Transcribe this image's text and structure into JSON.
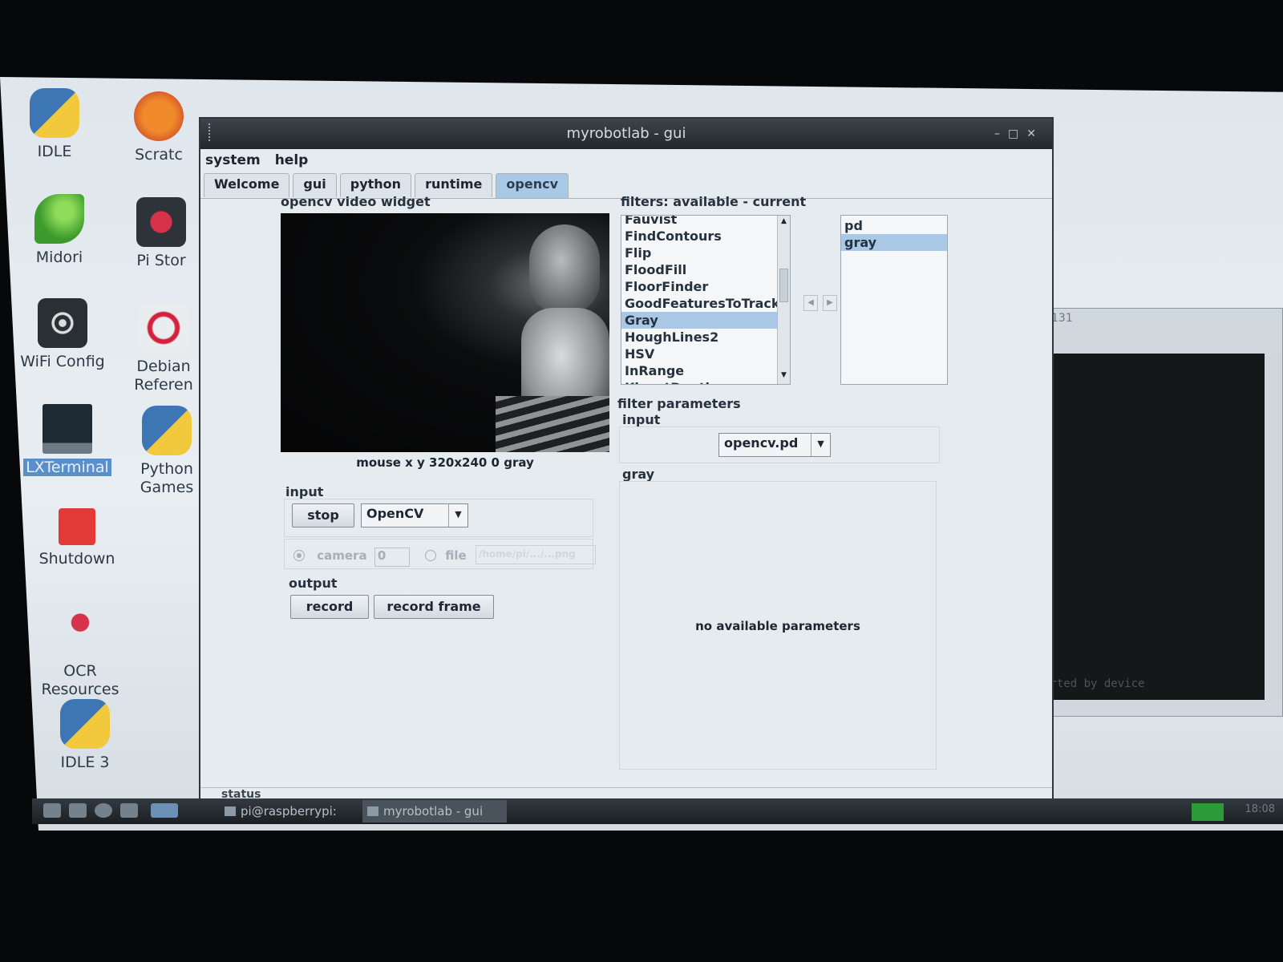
{
  "desktop": {
    "icons": [
      {
        "label": "IDLE",
        "icon": "python-icon"
      },
      {
        "label": "Scratc",
        "icon": "scratch-icon"
      },
      {
        "label": "Midori",
        "icon": "midori-icon"
      },
      {
        "label": "Pi Stor",
        "icon": "pi-store-icon"
      },
      {
        "label": "WiFi Config",
        "icon": "wifi-config-icon"
      },
      {
        "label": "Debian Referen",
        "icon": "debian-reference-icon"
      },
      {
        "label": "LXTerminal",
        "icon": "terminal-icon"
      },
      {
        "label": "Python Games",
        "icon": "python-games-icon"
      },
      {
        "label": "Shutdown",
        "icon": "shutdown-icon"
      },
      {
        "label": "OCR Resources",
        "icon": "ocr-icon"
      },
      {
        "label": "IDLE 3",
        "icon": "python3-icon"
      }
    ]
  },
  "background_window": {
    "title": "131",
    "terminal_text": "orted by device"
  },
  "app": {
    "title": "myrobotlab - gui",
    "menu": [
      "system",
      "help"
    ],
    "tabs": [
      {
        "label": "Welcome",
        "active": false
      },
      {
        "label": "gui",
        "active": false
      },
      {
        "label": "python",
        "active": false
      },
      {
        "label": "runtime",
        "active": false
      },
      {
        "label": "opencv",
        "active": true
      }
    ],
    "video": {
      "title": "opencv video widget",
      "mouse_info": "mouse x y 320x240 0 gray"
    },
    "input": {
      "title": "input",
      "stop_label": "stop",
      "source_value": "OpenCV",
      "camera_label": "camera",
      "camera_index": "0",
      "file_label": "file",
      "file_path": "/home/pi/.../...png"
    },
    "output": {
      "title": "output",
      "record_label": "record",
      "record_frame_label": "record frame"
    },
    "filters": {
      "title": "filters: available - current",
      "available": [
        "Fauvist",
        "FindContours",
        "Flip",
        "FloodFill",
        "FloorFinder",
        "GoodFeaturesToTrack",
        "Gray",
        "HoughLines2",
        "HSV",
        "InRange",
        "KinectDepth"
      ],
      "selected_available": "Gray",
      "current": [
        "pd",
        "gray"
      ],
      "selected_current": "gray"
    },
    "parameters": {
      "title": "filter parameters",
      "input_label": "input",
      "input_value": "opencv.pd",
      "filter_name": "gray",
      "empty_message": "no available parameters"
    },
    "status_label": "status"
  },
  "taskbar": {
    "tasks": [
      {
        "label": "pi@raspberrypi:",
        "active": false
      },
      {
        "label": "myrobotlab - gui",
        "active": true
      }
    ],
    "clock": "18:08"
  },
  "colors": {
    "accent": "#a9c8e6",
    "titlebar": "#2a3036",
    "window_bg": "#e6ebef",
    "tray_green": "#2c9a39"
  }
}
